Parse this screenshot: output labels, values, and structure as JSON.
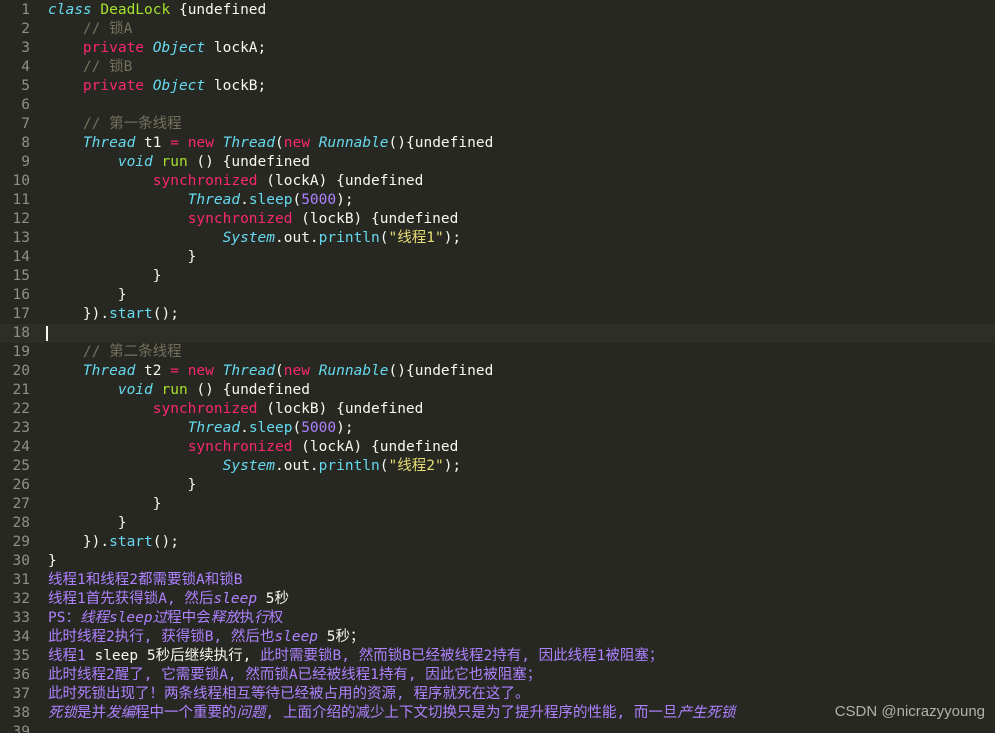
{
  "lines": [
    {
      "n": "1",
      "t": [
        [
          "kw-it",
          "class"
        ],
        [
          "plain",
          " "
        ],
        [
          "cls",
          "DeadLock"
        ],
        [
          "plain",
          " {undefined"
        ]
      ]
    },
    {
      "n": "2",
      "t": [
        [
          "plain",
          "    "
        ],
        [
          "cmt",
          "// 锁A"
        ]
      ]
    },
    {
      "n": "3",
      "t": [
        [
          "plain",
          "    "
        ],
        [
          "kw",
          "private"
        ],
        [
          "plain",
          " "
        ],
        [
          "kw-it",
          "Object"
        ],
        [
          "plain",
          " lockA;"
        ]
      ]
    },
    {
      "n": "4",
      "t": [
        [
          "plain",
          "    "
        ],
        [
          "cmt",
          "// 锁B"
        ]
      ]
    },
    {
      "n": "5",
      "t": [
        [
          "plain",
          "    "
        ],
        [
          "kw",
          "private"
        ],
        [
          "plain",
          " "
        ],
        [
          "kw-it",
          "Object"
        ],
        [
          "plain",
          " lockB;"
        ]
      ]
    },
    {
      "n": "6",
      "t": []
    },
    {
      "n": "7",
      "t": [
        [
          "plain",
          "    "
        ],
        [
          "cmt",
          "// 第一条线程"
        ]
      ]
    },
    {
      "n": "8",
      "t": [
        [
          "plain",
          "    "
        ],
        [
          "kw-it",
          "Thread"
        ],
        [
          "plain",
          " t1 "
        ],
        [
          "kw",
          "="
        ],
        [
          "plain",
          " "
        ],
        [
          "kw",
          "new"
        ],
        [
          "plain",
          " "
        ],
        [
          "kw-it",
          "Thread"
        ],
        [
          "plain",
          "("
        ],
        [
          "kw",
          "new"
        ],
        [
          "plain",
          " "
        ],
        [
          "kw-it",
          "Runnable"
        ],
        [
          "plain",
          "(){undefined"
        ]
      ]
    },
    {
      "n": "9",
      "t": [
        [
          "plain",
          "        "
        ],
        [
          "kw-it",
          "void"
        ],
        [
          "plain",
          " "
        ],
        [
          "fn2",
          "run"
        ],
        [
          "plain",
          " () {undefined"
        ]
      ]
    },
    {
      "n": "10",
      "t": [
        [
          "plain",
          "            "
        ],
        [
          "kw",
          "synchronized"
        ],
        [
          "plain",
          " (lockA) {undefined"
        ]
      ]
    },
    {
      "n": "11",
      "t": [
        [
          "plain",
          "                "
        ],
        [
          "kw-it",
          "Thread"
        ],
        [
          "plain",
          "."
        ],
        [
          "fn",
          "sleep"
        ],
        [
          "plain",
          "("
        ],
        [
          "num",
          "5000"
        ],
        [
          "plain",
          ");"
        ]
      ]
    },
    {
      "n": "12",
      "t": [
        [
          "plain",
          "                "
        ],
        [
          "kw",
          "synchronized"
        ],
        [
          "plain",
          " (lockB) {undefined"
        ]
      ]
    },
    {
      "n": "13",
      "t": [
        [
          "plain",
          "                    "
        ],
        [
          "kw-it",
          "System"
        ],
        [
          "plain",
          ".out."
        ],
        [
          "fn",
          "println"
        ],
        [
          "plain",
          "("
        ],
        [
          "str",
          "\"线程1\""
        ],
        [
          "plain",
          ");"
        ]
      ]
    },
    {
      "n": "14",
      "t": [
        [
          "plain",
          "                }"
        ]
      ]
    },
    {
      "n": "15",
      "t": [
        [
          "plain",
          "            }"
        ]
      ]
    },
    {
      "n": "16",
      "t": [
        [
          "plain",
          "        }"
        ]
      ]
    },
    {
      "n": "17",
      "t": [
        [
          "plain",
          "    })."
        ],
        [
          "fn",
          "start"
        ],
        [
          "plain",
          "();"
        ]
      ]
    },
    {
      "n": "18",
      "t": [],
      "active": true
    },
    {
      "n": "19",
      "t": [
        [
          "plain",
          "    "
        ],
        [
          "cmt",
          "// 第二条线程"
        ]
      ]
    },
    {
      "n": "20",
      "t": [
        [
          "plain",
          "    "
        ],
        [
          "kw-it",
          "Thread"
        ],
        [
          "plain",
          " t2 "
        ],
        [
          "kw",
          "="
        ],
        [
          "plain",
          " "
        ],
        [
          "kw",
          "new"
        ],
        [
          "plain",
          " "
        ],
        [
          "kw-it",
          "Thread"
        ],
        [
          "plain",
          "("
        ],
        [
          "kw",
          "new"
        ],
        [
          "plain",
          " "
        ],
        [
          "kw-it",
          "Runnable"
        ],
        [
          "plain",
          "(){undefined"
        ]
      ]
    },
    {
      "n": "21",
      "t": [
        [
          "plain",
          "        "
        ],
        [
          "kw-it",
          "void"
        ],
        [
          "plain",
          " "
        ],
        [
          "fn2",
          "run"
        ],
        [
          "plain",
          " () {undefined"
        ]
      ]
    },
    {
      "n": "22",
      "t": [
        [
          "plain",
          "            "
        ],
        [
          "kw",
          "synchronized"
        ],
        [
          "plain",
          " (lockB) {undefined"
        ]
      ]
    },
    {
      "n": "23",
      "t": [
        [
          "plain",
          "                "
        ],
        [
          "kw-it",
          "Thread"
        ],
        [
          "plain",
          "."
        ],
        [
          "fn",
          "sleep"
        ],
        [
          "plain",
          "("
        ],
        [
          "num",
          "5000"
        ],
        [
          "plain",
          ");"
        ]
      ]
    },
    {
      "n": "24",
      "t": [
        [
          "plain",
          "                "
        ],
        [
          "kw",
          "synchronized"
        ],
        [
          "plain",
          " (lockA) {undefined"
        ]
      ]
    },
    {
      "n": "25",
      "t": [
        [
          "plain",
          "                    "
        ],
        [
          "kw-it",
          "System"
        ],
        [
          "plain",
          ".out."
        ],
        [
          "fn",
          "println"
        ],
        [
          "plain",
          "("
        ],
        [
          "str",
          "\"线程2\""
        ],
        [
          "plain",
          ");"
        ]
      ]
    },
    {
      "n": "26",
      "t": [
        [
          "plain",
          "                }"
        ]
      ]
    },
    {
      "n": "27",
      "t": [
        [
          "plain",
          "            }"
        ]
      ]
    },
    {
      "n": "28",
      "t": [
        [
          "plain",
          "        }"
        ]
      ]
    },
    {
      "n": "29",
      "t": [
        [
          "plain",
          "    })."
        ],
        [
          "fn",
          "start"
        ],
        [
          "plain",
          "();"
        ]
      ]
    },
    {
      "n": "30",
      "t": [
        [
          "plain",
          "}"
        ]
      ]
    },
    {
      "n": "31",
      "t": [
        [
          "ann",
          "线程1和线程2都需要锁A和锁B"
        ]
      ]
    },
    {
      "n": "32",
      "t": [
        [
          "ann",
          "线程1首先获得锁A, 然后"
        ],
        [
          "ann-it",
          "sleep"
        ],
        [
          "ann-w",
          " 5秒"
        ]
      ]
    },
    {
      "n": "33",
      "t": [
        [
          "ann",
          "PS："
        ],
        [
          "ann-it",
          "线程sleep过"
        ],
        [
          "ann",
          "程中会"
        ],
        [
          "ann-it",
          "释放"
        ],
        [
          "ann",
          "执"
        ],
        [
          "ann-it",
          "行"
        ],
        [
          "ann",
          "权"
        ]
      ]
    },
    {
      "n": "34",
      "t": [
        [
          "ann",
          "此时线程2执行, 获得锁B, 然后也"
        ],
        [
          "ann-it",
          "sleep"
        ],
        [
          "ann-w",
          " 5秒；"
        ]
      ]
    },
    {
      "n": "35",
      "t": [
        [
          "ann",
          "线程1 "
        ],
        [
          "ann-w",
          "sleep 5秒后继续执行, "
        ],
        [
          "ann",
          "此时需要锁B, 然而锁B已经被线程2持有, 因此线程1被阻塞；"
        ]
      ]
    },
    {
      "n": "36",
      "t": [
        [
          "ann",
          "此时线程2醒了, 它需要锁A, 然而锁A已经被线程1持有, 因此它也被阻塞；"
        ]
      ]
    },
    {
      "n": "37",
      "t": [
        [
          "ann",
          "此时死锁出现了！两条线程相互等待已经被占用的资源, 程序就死在这了。"
        ]
      ]
    },
    {
      "n": "38",
      "t": [
        [
          "ann-it",
          "死锁"
        ],
        [
          "ann",
          "是并"
        ],
        [
          "ann-it",
          "发编"
        ],
        [
          "ann",
          "程中一个重要的"
        ],
        [
          "ann-it",
          "问题"
        ],
        [
          "ann",
          ", 上面介绍的减少上下文切换只是为了提升程序的性能, 而一旦"
        ],
        [
          "ann-it",
          "产生死锁"
        ]
      ]
    },
    {
      "n": "39",
      "t": []
    }
  ],
  "watermark": "CSDN @nicrazyyoung"
}
